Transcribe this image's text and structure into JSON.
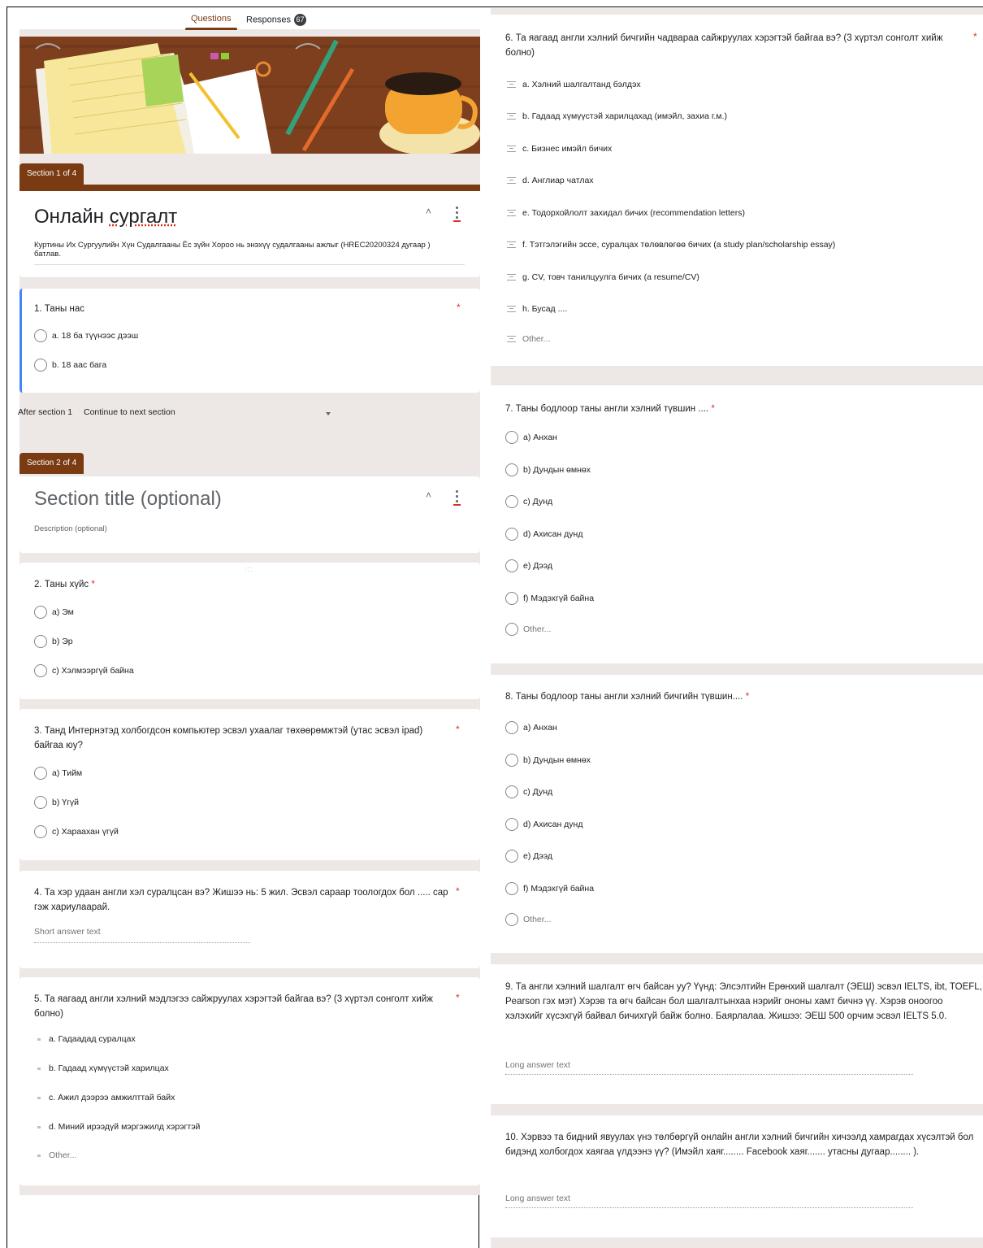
{
  "tabs": {
    "questions": "Questions",
    "responses": "Responses",
    "responses_count": "67"
  },
  "colors": {
    "theme": "#7a3a12",
    "accent_blue": "#4285f4",
    "required": "#d93025"
  },
  "section1": {
    "tab": "Section 1 of 4",
    "title_prefix": "Онлайн ",
    "title_spell": "сургалт",
    "description": "Куртины Их Сургуулийн Хүн Судалгааны Ёс зүйн Хороо нь энэхүү судалгааны ажлыг (HREC20200324 дугаар ) батлав."
  },
  "q1": {
    "title": "1.   Таны нас",
    "required": "*",
    "options": [
      "a. 18 ба түүнээс дээш",
      "b. 18 аас бага"
    ]
  },
  "after_section": {
    "label": "After section 1",
    "value": "Continue to next section"
  },
  "section2": {
    "tab": "Section 2 of 4",
    "title": "Section title (optional)",
    "description": "Description (optional)"
  },
  "q2": {
    "title": "2.   Таны хүйс",
    "required": "*",
    "options": [
      "a) Эм",
      "b) Эр",
      "c) Хэлмээргүй байна"
    ]
  },
  "q3": {
    "title": "3.   Танд Интернэтэд холбогдсон компьютер эсвэл ухаалаг төхөөрөмжтэй (утас эсвэл ipad) байгаа юу?",
    "required": "*",
    "options": [
      "a) Тийм",
      "b) Үгүй",
      "c) Хараахан үгүй"
    ]
  },
  "q4": {
    "title": "4.   Та хэр удаан англи хэл суралцсан вэ? Жишээ нь:  5 жил. Эсвэл сараар тоологдох бол ..... сар  гэж хариулаарай.",
    "required": "*",
    "placeholder": "Short answer text"
  },
  "q5": {
    "title": "5.   Та яагаад англи хэлний мэдлэгээ сайжруулах хэрэгтэй байгаа вэ? (3 хүртэл сонголт хийж болно)",
    "required": "*",
    "options": [
      "a. Гадаадад суралцах",
      "b. Гадаад хүмүүстэй харилцах",
      "c. Ажил дээрээ амжилттай байх",
      "d.  Миний ирээдүй мэргэжилд хэрэгтэй",
      "Other..."
    ]
  },
  "q6": {
    "title": "6.   Та яагаад англи хэлний бичгийн чадвараа сайжруулах хэрэгтэй байгаа вэ? (3 хүртэл сонголт хийж болно)",
    "required": "*",
    "options": [
      "a. Хэлний шалгалтанд бэлдэх",
      "b. Гадаад хүмүүстэй харилцахад (имэйл, захиа г.м.)",
      "c. Бизнес имэйл бичих",
      "d. Англиар чатлах",
      "e. Тодорхойлолт захидал бичих (recommendation letters)",
      "f. Тэтгэлэгийн эссе, суралцах төлөвлөгөө бичих (a study plan/scholarship essay)",
      "g. CV, товч танилцуулга бичих  (a resume/CV)",
      "h. Бусад ....",
      "Other..."
    ]
  },
  "q7": {
    "title": "7.   Таны бодлоор таны англи хэлний түвшин ....",
    "required": "*",
    "options": [
      "a) Анхан",
      "b) Дундын өмнөх",
      "c) Дунд",
      "d) Ахисан дунд",
      "e) Дээд",
      "f) Мэдэхгүй байна",
      "Other..."
    ]
  },
  "q8": {
    "title": "8.   Таны бодлоор таны англи хэлний бичгийн түвшин....",
    "required": "*",
    "options": [
      "a) Анхан",
      "b) Дундын өмнөх",
      "c) Дунд",
      "d) Ахисан дунд",
      "e) Дээд",
      "f) Мэдэхгүй байна",
      "Other..."
    ]
  },
  "q9": {
    "title": "9.   Та англи хэлний шалгалт өгч байсан уу? Үүнд: Элсэлтийн Ерөнхий шалгалт (ЭЕШ) эсвэл IELTS, ibt, TOEFL, Pearson гэх мэт) Хэрэв та өгч байсан бол шалгалтынхаа нэрийг ононы хамт бичнэ үү. Хэрэв оноогоо хэлэхийг хүсэхгүй байвал бичихгүй байж болно. Баярлалаа.  Жишээ: ЭЕШ 500 орчим эсвэл IELTS 5.0.",
    "placeholder": "Long answer text"
  },
  "q10": {
    "title": "10.  Хэрвээ та бидний явуулах үнэ төлбөргүй онлайн англи хэлний бичгийн хичээлд хамрагдах хүсэлтэй бол бидэнд  холбогдох хаягаа үлдээнэ үү?  (Имэйл хаяг........  Facebook хаяг....... утасны дугаар........ ).",
    "placeholder": "Long answer text"
  }
}
